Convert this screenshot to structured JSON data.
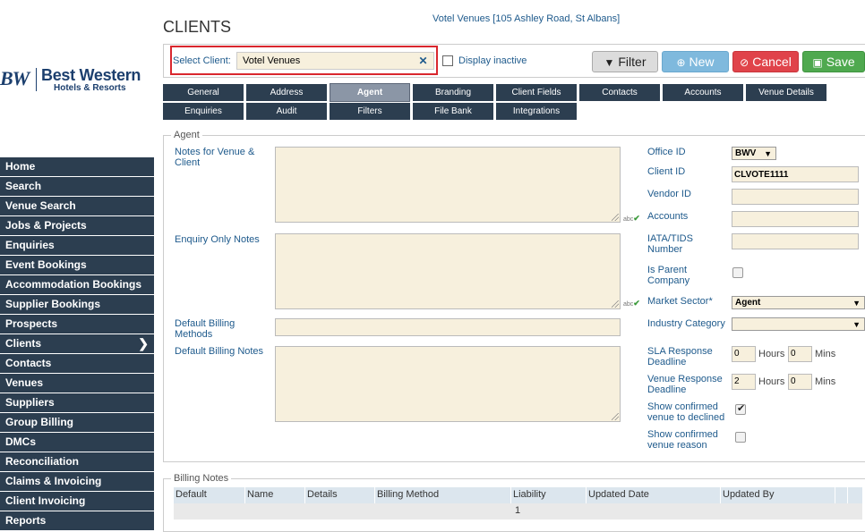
{
  "header": {
    "page_title": "CLIENTS",
    "venue_link": "Votel Venues [105 Ashley Road, St Albans]"
  },
  "logo": {
    "mark": "BW",
    "line1": "Best Western",
    "line2": "Hotels & Resorts"
  },
  "nav": {
    "items": [
      {
        "label": "Home"
      },
      {
        "label": "Search"
      },
      {
        "label": "Venue Search"
      },
      {
        "label": "Jobs & Projects"
      },
      {
        "label": "Enquiries"
      },
      {
        "label": "Event Bookings"
      },
      {
        "label": "Accommodation Bookings"
      },
      {
        "label": "Supplier Bookings"
      },
      {
        "label": "Prospects"
      },
      {
        "label": "Clients"
      },
      {
        "label": "Contacts"
      },
      {
        "label": "Venues"
      },
      {
        "label": "Suppliers"
      },
      {
        "label": "Group Billing"
      },
      {
        "label": "DMCs"
      },
      {
        "label": "Reconciliation"
      },
      {
        "label": "Claims & Invoicing"
      },
      {
        "label": "Client Invoicing"
      },
      {
        "label": "Reports"
      }
    ],
    "active_index": 9
  },
  "toolbar": {
    "select_label": "Select Client:",
    "select_value": "Votel Venues",
    "display_inactive": "Display inactive",
    "filter": "Filter",
    "new": "New",
    "cancel": "Cancel",
    "save": "Save"
  },
  "tabs": [
    "General",
    "Address",
    "Agent",
    "Branding",
    "Client Fields",
    "Contacts",
    "Accounts",
    "Venue Details",
    "Enquiries",
    "Audit",
    "Filters",
    "File Bank",
    "Integrations"
  ],
  "active_tab": "Agent",
  "agent": {
    "legend": "Agent",
    "notes_label": "Notes for Venue & Client",
    "enquiry_notes_label": "Enquiry Only Notes",
    "billing_methods_label": "Default Billing Methods",
    "billing_notes_label": "Default Billing Notes",
    "spell_marker": "abc",
    "office_id_label": "Office ID",
    "office_id_value": "BWV",
    "client_id_label": "Client ID",
    "client_id_value": "CLVOTE1111",
    "vendor_id_label": "Vendor ID",
    "accounts_label": "Accounts",
    "iata_label": "IATA/TIDS Number",
    "is_parent_label": "Is Parent Company",
    "market_sector_label": "Market Sector*",
    "market_sector_value": "Agent",
    "industry_category_label": "Industry Category",
    "sla_label": "SLA Response Deadline",
    "sla_hours": "0",
    "sla_mins": "0",
    "venue_response_label": "Venue Response Deadline",
    "venue_hours": "2",
    "venue_mins": "0",
    "hours_unit": "Hours",
    "mins_unit": "Mins",
    "show_confirmed_label": "Show confirmed venue to declined",
    "show_confirmed_checked": true,
    "show_confirmed_reason_label": "Show confirmed venue reason",
    "show_confirmed_reason_checked": false
  },
  "billing_notes": {
    "legend": "Billing Notes",
    "columns": [
      "Default",
      "Name",
      "Details",
      "Billing Method",
      "Liability",
      "Updated Date",
      "Updated By"
    ],
    "page": "1"
  },
  "colors": {
    "nav_bg": "#2c3e50",
    "accent": "#1e5a8c",
    "field_bg": "#f7f0dd",
    "highlight": "#d9272e"
  }
}
